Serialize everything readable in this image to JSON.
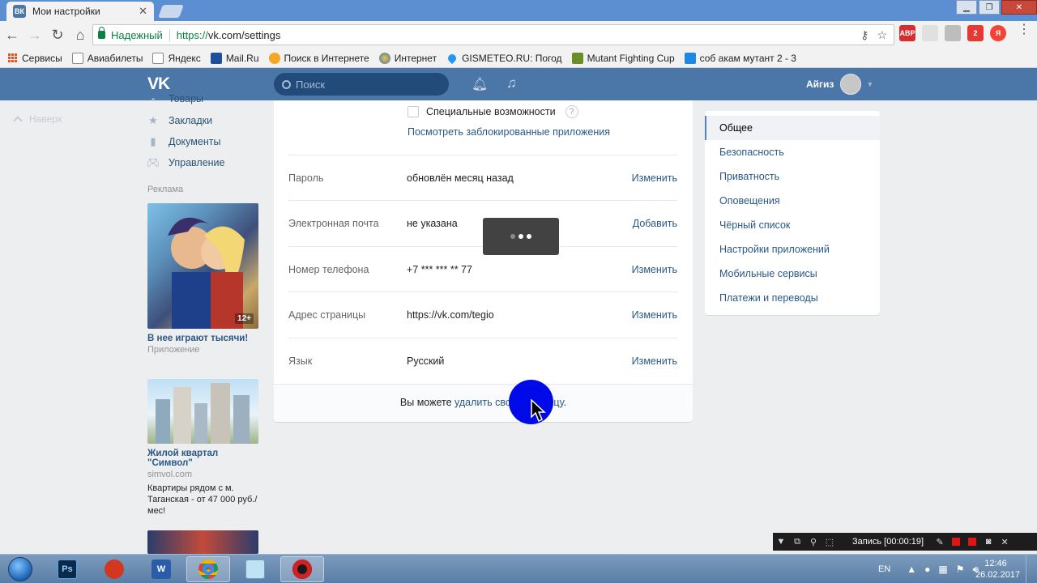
{
  "browser": {
    "tab_title": "Мои настройки",
    "tab_favicon": "ВК",
    "tab_close": "✕",
    "secure_label": "Надежный",
    "url_scheme": "https://",
    "url_rest": "vk.com/settings",
    "bookmarks": [
      {
        "label": "Сервисы",
        "icon": "apps-icon"
      },
      {
        "label": "Авиабилеты",
        "icon": "page-icon"
      },
      {
        "label": "Яндекс",
        "icon": "page-icon"
      },
      {
        "label": "Mail.Ru",
        "icon": "mailru-icon"
      },
      {
        "label": "Поиск в Интернете",
        "icon": "search-bulb-icon"
      },
      {
        "label": "Интернет",
        "icon": "globe-icon"
      },
      {
        "label": "GISMETEO.RU: Погод",
        "icon": "drop-icon"
      },
      {
        "label": "Mutant Fighting Cup",
        "icon": "game-icon"
      },
      {
        "label": "соб акам мутант 2 - 3",
        "icon": "search-icon"
      }
    ],
    "ext_badges": [
      "ABP",
      "2",
      "2"
    ]
  },
  "vk": {
    "logo": "VK",
    "search_placeholder": "Поиск",
    "user_name": "Айгиз"
  },
  "left": {
    "back_to_top": "Наверх",
    "menu": [
      {
        "label": "Товары",
        "icon": "goods-icon"
      },
      {
        "label": "Закладки",
        "icon": "star-icon"
      },
      {
        "label": "Документы",
        "icon": "document-icon"
      },
      {
        "label": "Управление",
        "icon": "gamepad-icon"
      }
    ],
    "ads_label": "Реклама",
    "ads": [
      {
        "title": "В нее играют тысячи!",
        "subtitle": "Приложение",
        "badge": "12+",
        "description": ""
      },
      {
        "title": "Жилой квартал \"Символ\"",
        "subtitle": "simvol.com",
        "description": "Квартиры рядом с м. Таганская - от 47 000 руб./мес!"
      }
    ]
  },
  "settings": {
    "special_features_label": "Специальные возможности",
    "help_mark": "?",
    "blocked_apps_link": "Посмотреть заблокированные приложения",
    "rows": [
      {
        "label": "Пароль",
        "value": "обновлён месяц назад",
        "action": "Изменить"
      },
      {
        "label": "Электронная почта",
        "value": "не указана",
        "action": "Добавить"
      },
      {
        "label": "Номер телефона",
        "value": "+7 *** *** ** 77",
        "action": "Изменить"
      },
      {
        "label": "Адрес страницы",
        "value": "https://vk.com/tegio",
        "action": "Изменить"
      },
      {
        "label": "Язык",
        "value": "Русский",
        "action": "Изменить"
      }
    ],
    "footer_prefix": "Вы можете ",
    "footer_link": "удалить свою страницу",
    "footer_suffix": "."
  },
  "right_nav": {
    "items": [
      {
        "label": "Общее",
        "active": true
      },
      {
        "label": "Безопасность",
        "active": false
      },
      {
        "label": "Приватность",
        "active": false
      },
      {
        "label": "Оповещения",
        "active": false
      },
      {
        "label": "Чёрный список",
        "active": false
      },
      {
        "label": "Настройки приложений",
        "active": false
      },
      {
        "label": "Мобильные сервисы",
        "active": false
      },
      {
        "label": "Платежи и переводы",
        "active": false
      }
    ]
  },
  "recorder": {
    "label": "Запись [00:00:19]"
  },
  "taskbar": {
    "apps": [
      "start",
      "photoshop",
      "cleaner",
      "word",
      "chrome",
      "notepad",
      "recorder"
    ],
    "photoshop_label": "Ps",
    "word_label": "W",
    "language": "EN",
    "time": "12:46",
    "date": "26.02.2017"
  },
  "colors": {
    "vk_blue": "#4a76a8",
    "vk_link": "#2a5885",
    "secure_green": "#0b8043",
    "cursor_highlight": "#0009e8"
  }
}
